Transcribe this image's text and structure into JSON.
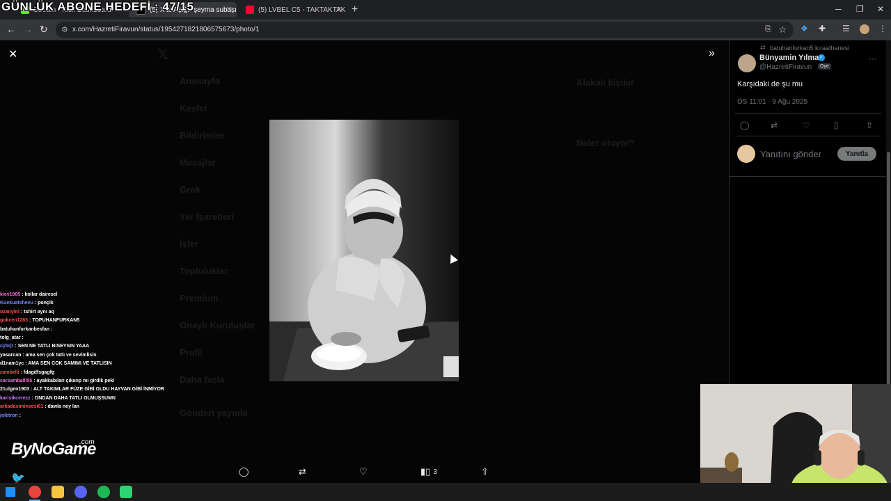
{
  "stream_overlay": {
    "title": "GÜNLÜK ABONE HEDEFİ : 47/15",
    "brand": "ByNoGame",
    "brand_suffix": ".com"
  },
  "browser": {
    "tabs": [
      {
        "label": "Stream - Kick Dashboard",
        "color": "#53fc18",
        "active": false
      },
      {
        "label": "(5) X'te Aşığı \"şeyma subaşı d...",
        "color": "#ffffff",
        "active": true
      },
      {
        "label": "(5) LVBEL C5 - TAKTAKTAK (...",
        "color": "#ff0033",
        "active": false
      }
    ],
    "url": "x.com/HazretiFiravun/status/1954271821806575673/photo/1"
  },
  "viewer": {
    "background_menu": [
      "Anasayfa",
      "Keşfet",
      "Bildirimler",
      "Mesajlar",
      "Grok",
      "Yer İşaretleri",
      "İşler",
      "Topluluklar",
      "Premium",
      "Onaylı Kuruluşlar",
      "Profil",
      "Daha fazla"
    ],
    "post_button": "Gönderi yayınla",
    "right_headings": [
      "Alakalı kişiler",
      "Neler oluyor?"
    ],
    "actions": {
      "views_count": "3"
    }
  },
  "tweet": {
    "reposted_by": "batuhanfurkan5 kıraathanesi",
    "author_name": "Bünyamin Yılmaz",
    "handle": "@HazretiFiravun",
    "badge": "Oye",
    "text": "Karşıdaki de şu mu",
    "time": "ÖS 11:01 · 9 Ağu 2025",
    "reply_placeholder": "Yanıtını gönder",
    "reply_button": "Yanıtla"
  },
  "chat": [
    {
      "user": "kiev1905",
      "msg": "kollar dairesel",
      "color": "#ff6ad5"
    },
    {
      "user": "Kuekuatsheeu",
      "msg": "ponçik",
      "color": "#7a86ff"
    },
    {
      "user": "ozanylnl",
      "msg": "tshirt aynı aq",
      "color": "#ff4b4b"
    },
    {
      "user": "gokcen1283",
      "msg": "TOPUHANFURKAN5",
      "color": "#ff4b4b"
    },
    {
      "user": "batuhanfurkanbesfan",
      "msg": "",
      "color": "#ffffff"
    },
    {
      "user": "tolg_atar",
      "msg": "",
      "color": "#ffffff"
    },
    {
      "user": "cybrjr",
      "msg": "SEN NE TATLI BISEYSIN YAAA",
      "color": "#7a86ff"
    },
    {
      "user": "yasarcan",
      "msg": "ama sen çok tatlı ve sevimlisin",
      "color": "#ffffff"
    },
    {
      "user": "d1nam1yc",
      "msg": "AMA SEN COK SAMIMI VE TATLISIN",
      "color": "#ffffff"
    },
    {
      "user": "zambelli",
      "msg": "fdagdfsgagfg",
      "color": "#ff4b4b"
    },
    {
      "user": "carsamballi55",
      "msg": "ayakkabıları çıkarıp mı girdik peki",
      "color": "#ff6ad5"
    },
    {
      "user": "21ulgen1903",
      "msg": "ALT TAKIMLAR FÜZE GİBİ OLDU HAYVAN GİBİ İNMİYOR",
      "color": "#ffffff"
    },
    {
      "user": "karisikcerezz",
      "msg": "ONDAN DAHA TATLI OLMUŞSUMN",
      "color": "#c77dff"
    },
    {
      "user": "arkadasiminsesi61",
      "msg": "dawla ney lan",
      "color": "#ff4b4b"
    },
    {
      "user": "joletron",
      "msg": "",
      "color": "#7a86ff"
    }
  ]
}
